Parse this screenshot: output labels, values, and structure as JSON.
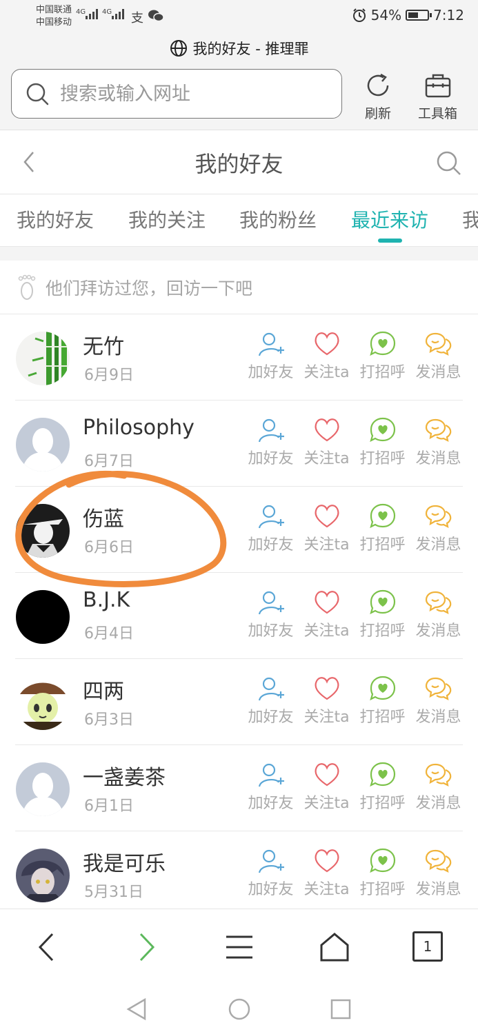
{
  "status_bar": {
    "carrier1": "中国联通",
    "carrier2": "中国移动",
    "net1": "4G",
    "net2": "4G",
    "battery": "54%",
    "battery_level": 0.54,
    "time": "7:12"
  },
  "page_title": "我的好友 - 推理罪",
  "address_bar": {
    "placeholder": "搜索或输入网址",
    "refresh_label": "刷新",
    "toolbox_label": "工具箱"
  },
  "header": {
    "title": "我的好友"
  },
  "tabs": [
    {
      "label": "我的好友",
      "active": false
    },
    {
      "label": "我的关注",
      "active": false
    },
    {
      "label": "我的粉丝",
      "active": false
    },
    {
      "label": "最近来访",
      "active": true
    },
    {
      "label": "我",
      "active": false
    }
  ],
  "hint_text": "他们拜访过您，回访一下吧",
  "actions": {
    "add_friend": "加好友",
    "follow": "关注ta",
    "greet": "打招呼",
    "message": "发消息"
  },
  "colors": {
    "accent": "#1fb3b0",
    "add_friend_icon": "#5aa6d6",
    "follow_icon": "#e8676b",
    "greet_icon": "#7cc24a",
    "message_icon": "#f0b33a",
    "annotation_circle": "#f08b3c"
  },
  "visitors": [
    {
      "name": "无竹",
      "date": "6月9日",
      "avatar": "bamboo"
    },
    {
      "name": "Philosophy",
      "date": "6月7日",
      "avatar": "default"
    },
    {
      "name": "伤蓝",
      "date": "6月6日",
      "avatar": "hat-man"
    },
    {
      "name": "B.J.K",
      "date": "6月4日",
      "avatar": "black"
    },
    {
      "name": "四两",
      "date": "6月3日",
      "avatar": "anime-girl"
    },
    {
      "name": "一盏姜茶",
      "date": "6月1日",
      "avatar": "default"
    },
    {
      "name": "我是可乐",
      "date": "5月31日",
      "avatar": "anime-boy"
    }
  ]
}
